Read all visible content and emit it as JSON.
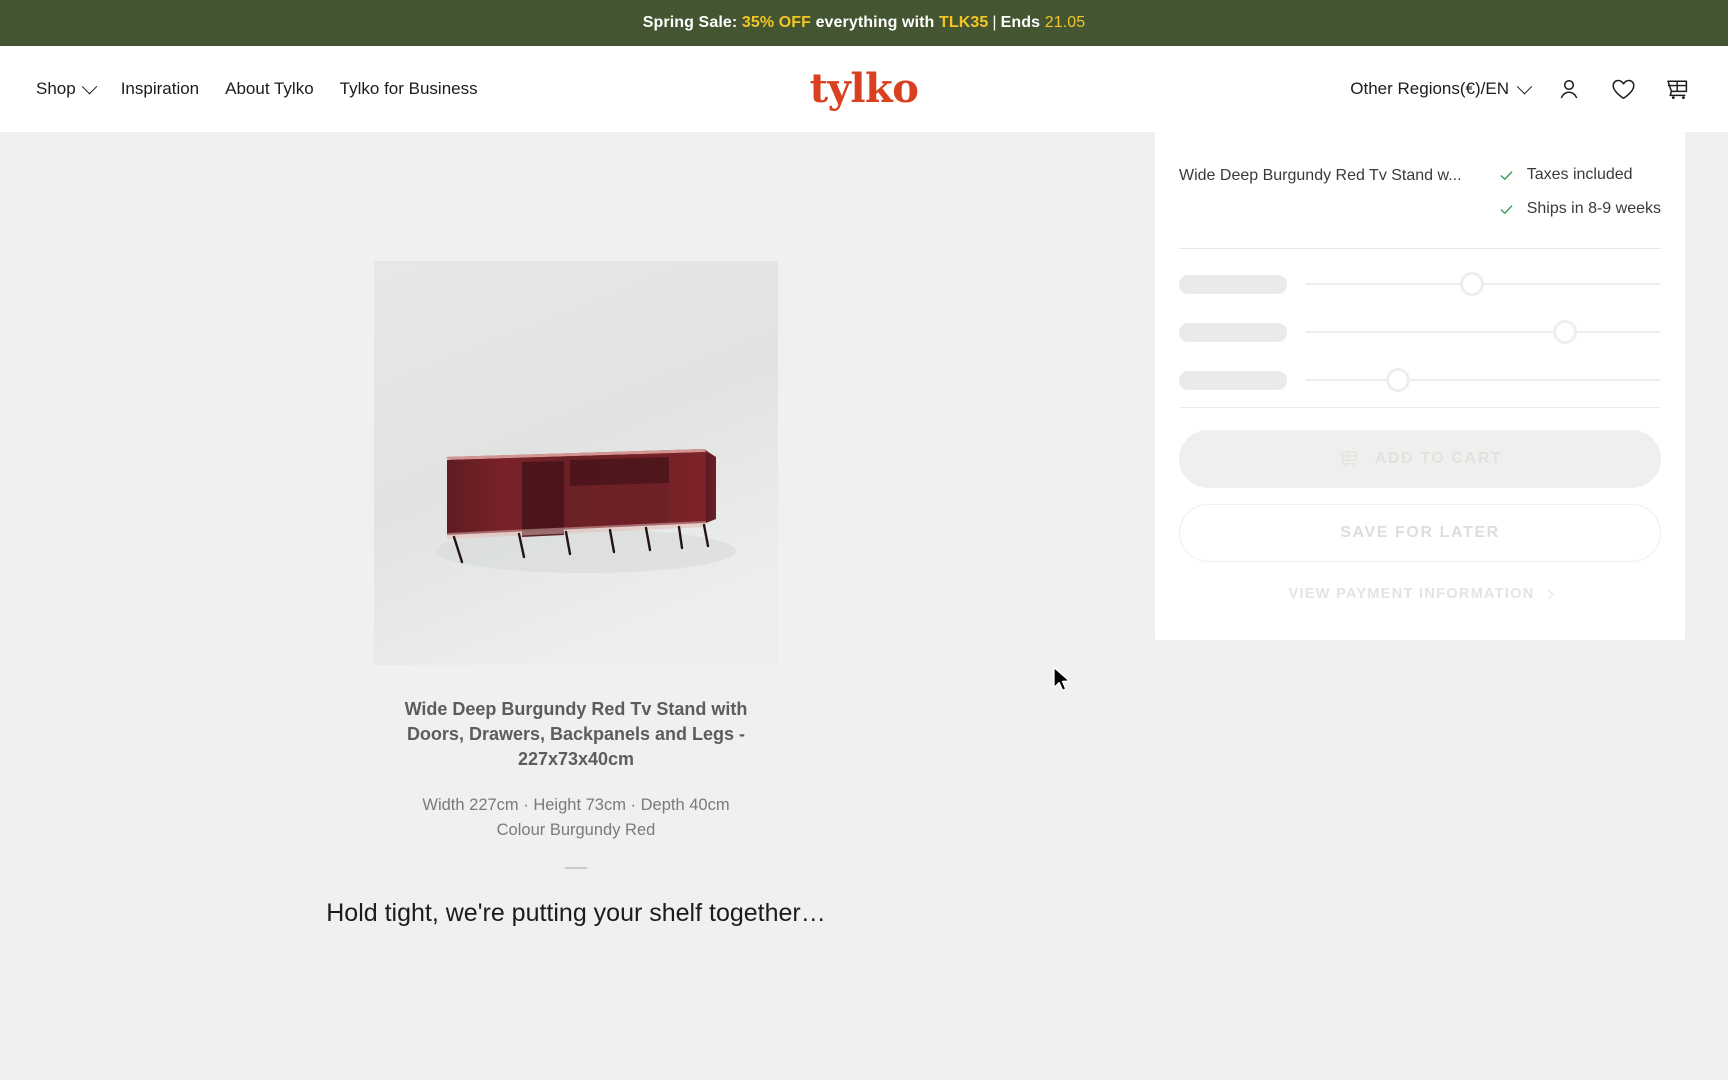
{
  "promo": {
    "prefix": "Spring Sale:",
    "discount": "35% OFF",
    "middle": "everything with",
    "code": "TLK35",
    "separator": "|",
    "ends_label": "Ends",
    "ends_date": "21.05",
    "background_color": "#435531",
    "highlight_color": "#f3c623"
  },
  "header": {
    "nav": [
      {
        "label": "Shop",
        "has_dropdown": true
      },
      {
        "label": "Inspiration",
        "has_dropdown": false
      },
      {
        "label": "About Tylko",
        "has_dropdown": false
      },
      {
        "label": "Tylko for Business",
        "has_dropdown": false
      }
    ],
    "brand": "tylko",
    "brand_color": "#d9401f",
    "region": "Other Regions(€)/EN",
    "icons": [
      {
        "name": "account-icon",
        "glyph": "person"
      },
      {
        "name": "wishlist-icon",
        "glyph": "heart"
      },
      {
        "name": "cart-icon",
        "glyph": "cart"
      }
    ]
  },
  "product": {
    "title": "Wide Deep Burgundy Red Tv Stand with Doors, Drawers, Backpanels and Legs - 227x73x40cm",
    "specs_line_1": "Width 227cm · Height 73cm · Depth 40cm",
    "specs_line_2": "Colour Burgundy Red",
    "loading_message": "Hold tight, we're putting your shelf together…",
    "image_alt": "burgundy-red-tv-stand-render",
    "colour_hex": "#6d2328"
  },
  "config_panel": {
    "product_name_truncated": "Wide Deep Burgundy Red Tv Stand w...",
    "badges": [
      {
        "icon": "check-icon",
        "label": "Taxes included"
      },
      {
        "icon": "check-icon",
        "label": "Ships in 8-9 weeks"
      }
    ],
    "check_color": "#3f9c5b",
    "sliders": [
      {
        "label_placeholder": "",
        "value_percent": 47
      },
      {
        "label_placeholder": "",
        "value_percent": 73
      },
      {
        "label_placeholder": "",
        "value_percent": 26
      }
    ],
    "add_to_cart_label": "ADD TO CART",
    "save_for_later_label": "SAVE FOR LATER",
    "payment_info_label": "VIEW PAYMENT INFORMATION",
    "state": "loading"
  }
}
